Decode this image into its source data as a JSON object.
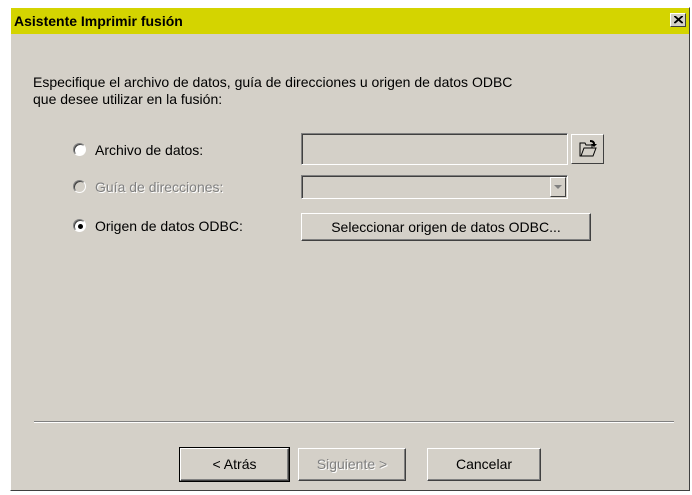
{
  "window": {
    "title": "Asistente Imprimir fusión",
    "close_icon": "close-icon",
    "title_color": "#d4d400"
  },
  "instruction": {
    "line1": "Especifique el archivo de datos, guía de direcciones u origen de datos ODBC",
    "line2": "que desee utilizar en la fusión:"
  },
  "options": {
    "archivo": {
      "label": "Archivo de datos:",
      "selected": false,
      "enabled": true
    },
    "guia": {
      "label": "Guía de direcciones:",
      "selected": false,
      "enabled": false
    },
    "odbc": {
      "label": "Origen de datos ODBC:",
      "selected": true,
      "enabled": true
    }
  },
  "archivo_field": {
    "value": "",
    "browse_icon": "folder-open-icon"
  },
  "guia_combo": {
    "value": "",
    "arrow_icon": "chevron-down-icon"
  },
  "odbc_button": {
    "label": "Seleccionar origen de datos ODBC..."
  },
  "footer": {
    "back_label": "< Atrás",
    "next_label": "Siguiente >",
    "cancel_label": "Cancelar"
  }
}
